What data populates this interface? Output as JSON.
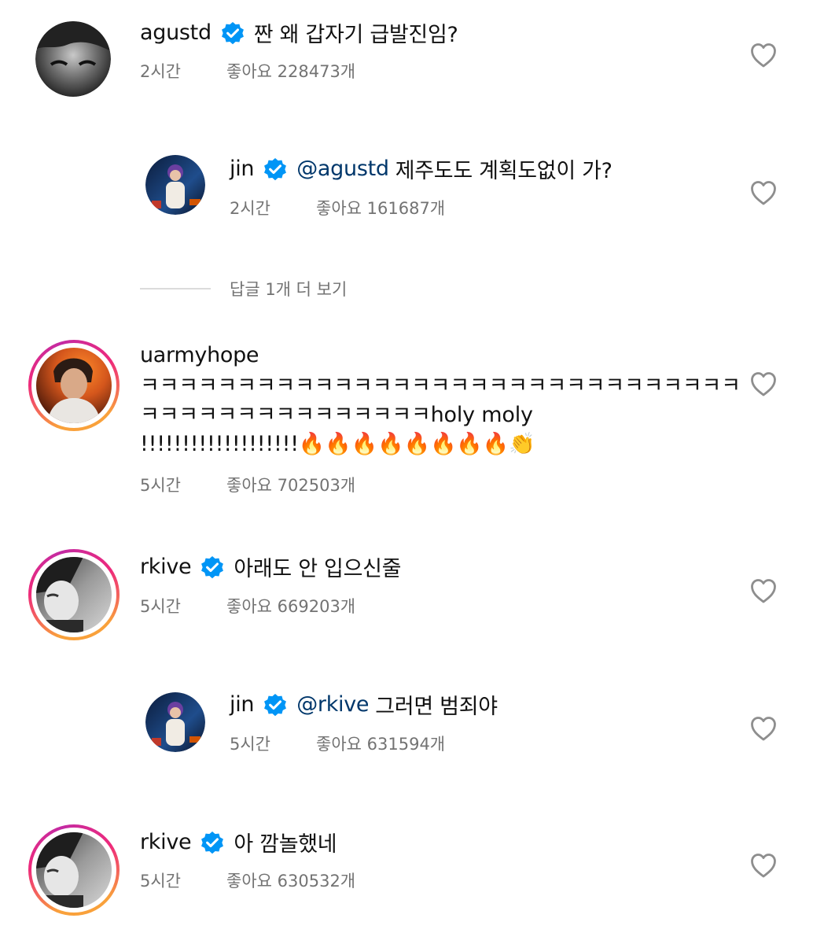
{
  "comments": [
    {
      "username": "agustd",
      "text": "짠 왜 갑자기 급발진임?",
      "time": "2시간",
      "likes": "좋아요 228473개"
    },
    {
      "username": "jin",
      "mention": "@agustd",
      "text": "제주도도 계획도없이 가?",
      "time": "2시간",
      "likes": "좋아요 161687개"
    },
    {
      "username": "uarmyhope",
      "text_lines": [
        "ㅋㅋㅋㅋㅋㅋㅋㅋㅋㅋㅋㅋㅋㅋㅋㅋㅋㅋㅋㅋㅋㅋㅋㅋㅋㅋㅋㅋㅋㅋㅋ",
        "ㅋㅋㅋㅋㅋㅋㅋㅋㅋㅋㅋㅋㅋㅋㅋholy moly",
        "!!!!!!!!!!!!!!!!!!!🔥🔥🔥🔥🔥🔥🔥🔥👏"
      ],
      "time": "5시간",
      "likes": "좋아요 702503개"
    },
    {
      "username": "rkive",
      "text": "아래도 안 입으신줄",
      "time": "5시간",
      "likes": "좋아요 669203개"
    },
    {
      "username": "jin",
      "mention": "@rkive",
      "text": "그러면 범죄야",
      "time": "5시간",
      "likes": "좋아요 631594개"
    },
    {
      "username": "rkive",
      "text": "아 깜놀했네",
      "time": "5시간",
      "likes": "좋아요 630532개"
    }
  ],
  "view_replies": "답글 1개 더 보기",
  "colors": {
    "verified": "#0095f6",
    "mention": "#00376b",
    "meta": "#737373",
    "heart_outline": "#8e8e8e"
  },
  "icons": {
    "verified": "verified-badge-icon",
    "heart": "heart-outline-icon"
  }
}
